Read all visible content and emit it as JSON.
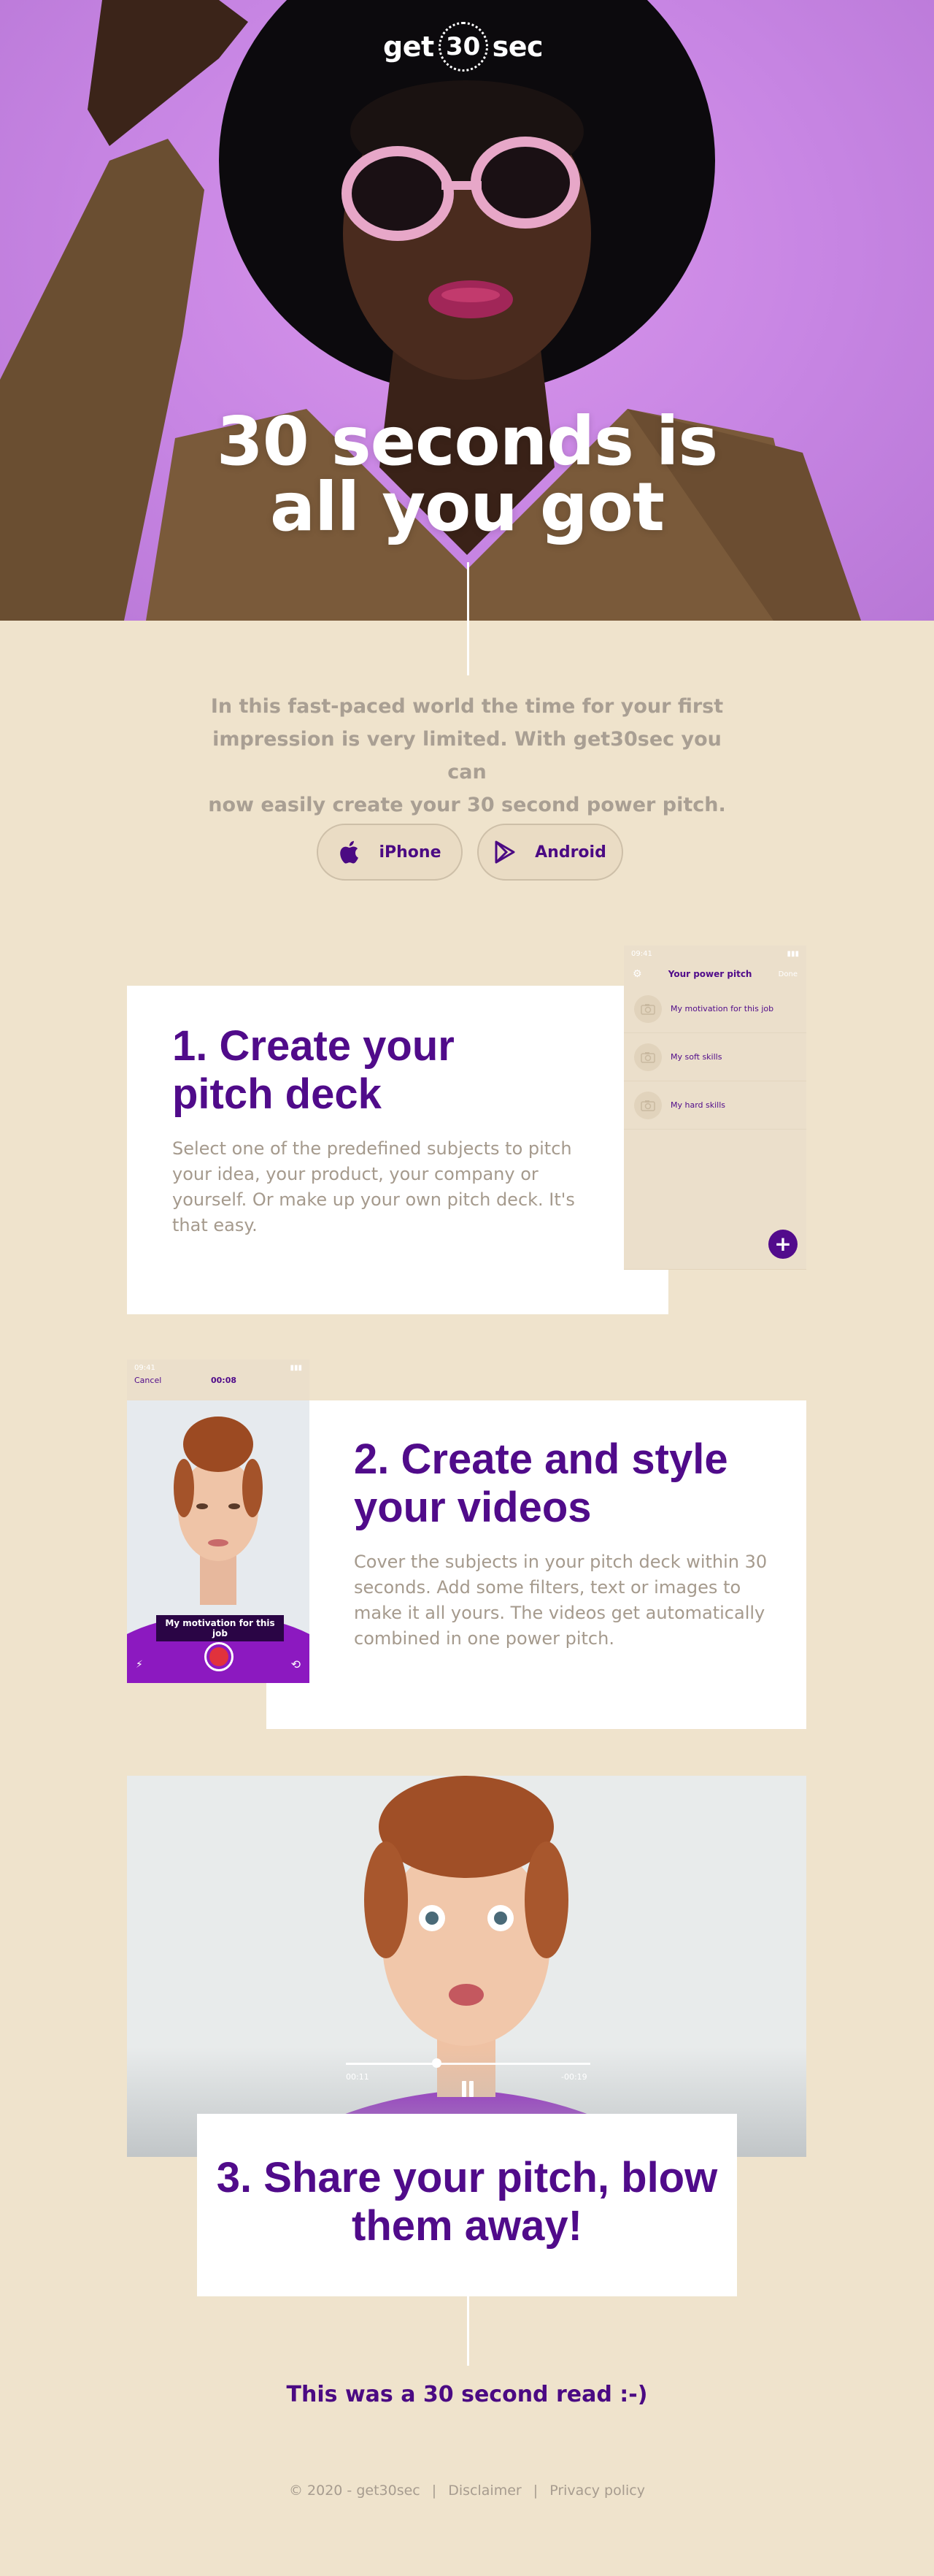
{
  "brand": {
    "pre": "get",
    "ring": "30",
    "post": "sec",
    "accent": "#4b0a83",
    "hero_bg": "#d996ec",
    "page_bg": "#efe3cc"
  },
  "hero": {
    "title_line1": "30 seconds is",
    "title_line2": "all you got"
  },
  "intro": {
    "line1": "In this fast-paced world the time for your first",
    "line2": "impression is very limited. With get30sec you can",
    "line3": "now easily create your 30 second power pitch."
  },
  "stores": [
    {
      "label": "iPhone",
      "icon": "apple-icon"
    },
    {
      "label": "Android",
      "icon": "google-play-icon"
    }
  ],
  "step1": {
    "title": "1. Create your pitch deck",
    "body": "Select one of the predefined subjects to pitch your idea, your product, your company or yourself. Or make up your own pitch deck. It's that easy.",
    "phone": {
      "time": "09:41",
      "title": "Your power pitch",
      "done": "Done",
      "items": [
        "My motivation for this job",
        "My soft skills",
        "My hard skills"
      ],
      "fab": "+"
    }
  },
  "step2": {
    "title": "2. Create and style your videos",
    "body": "Cover the subjects in your pitch deck within 30 seconds. Add some filters, text or images to make it all yours. The videos get automatically combined in one power pitch.",
    "phone": {
      "time": "09:41",
      "cancel": "Cancel",
      "timer": "00:08",
      "caption": "My motivation for this job"
    }
  },
  "step3": {
    "title": "3. Share your pitch, blow them away!",
    "video": {
      "elapsed": "00:11",
      "remaining": "-00:19",
      "progress": 0.37
    }
  },
  "closing": "This was a 30 second read :-)",
  "footer": {
    "copyright": "© 2020 - get30sec",
    "disclaimer": "Disclaimer",
    "privacy": "Privacy policy"
  }
}
